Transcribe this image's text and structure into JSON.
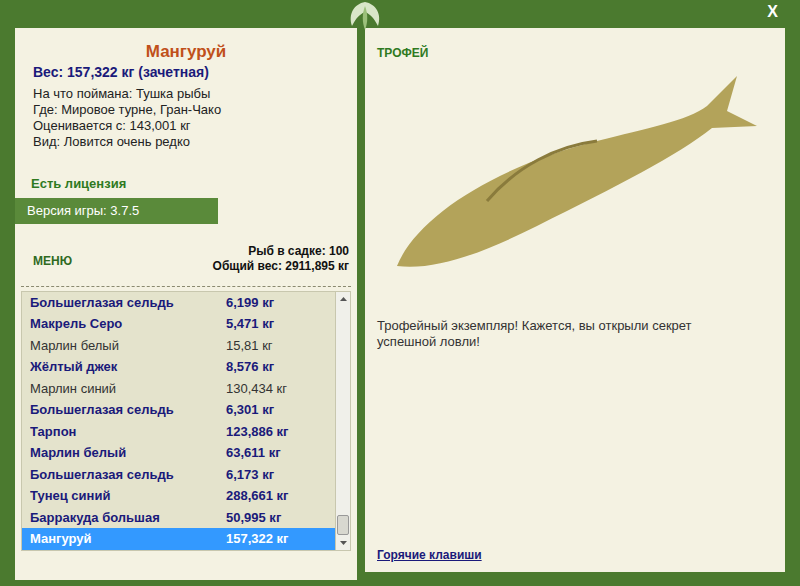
{
  "window": {
    "close": "X"
  },
  "fish": {
    "name": "Мангуруй",
    "weight": "Вес: 157,322 кг (зачетная)",
    "details": [
      "На что поймана: Тушка рыбы",
      "Где: Мировое турне, Гран-Чако",
      "Оценивается с: 143,001 кг",
      "Вид: Ловится очень редко"
    ]
  },
  "license": "Есть лицензия",
  "version": "Версия игры: 3.7.5",
  "menu_button": "МЕНЮ",
  "keepnet": {
    "count": "Рыб в садке: 100",
    "total": "Общий вес: 2911,895 кг"
  },
  "catch_list": [
    {
      "name": "Большеглазая сельдь",
      "weight": "6,199 кг",
      "emphasized": true,
      "selected": false
    },
    {
      "name": "Макрель Серо",
      "weight": "5,471 кг",
      "emphasized": true,
      "selected": false
    },
    {
      "name": "Марлин белый",
      "weight": "15,81 кг",
      "emphasized": false,
      "selected": false
    },
    {
      "name": "Жёлтый джек",
      "weight": "8,576 кг",
      "emphasized": true,
      "selected": false
    },
    {
      "name": "Марлин синий",
      "weight": "130,434 кг",
      "emphasized": false,
      "selected": false
    },
    {
      "name": "Большеглазая сельдь",
      "weight": "6,301 кг",
      "emphasized": true,
      "selected": false
    },
    {
      "name": "Тарпон",
      "weight": "123,886 кг",
      "emphasized": true,
      "selected": false
    },
    {
      "name": "Марлин белый",
      "weight": "63,611 кг",
      "emphasized": true,
      "selected": false
    },
    {
      "name": "Большеглазая сельдь",
      "weight": "6,173 кг",
      "emphasized": true,
      "selected": false
    },
    {
      "name": "Тунец синий",
      "weight": "288,661 кг",
      "emphasized": true,
      "selected": false
    },
    {
      "name": "Барракуда большая",
      "weight": "50,995 кг",
      "emphasized": true,
      "selected": false
    },
    {
      "name": "Мангуруй",
      "weight": "157,322 кг",
      "emphasized": true,
      "selected": true
    }
  ],
  "trophy": {
    "label": "ТРОФЕЙ",
    "message": "Трофейный экземпляр! Кажется, вы открыли секрет успешной ловли!"
  },
  "hotkeys_link": "Горячие клавиши"
}
